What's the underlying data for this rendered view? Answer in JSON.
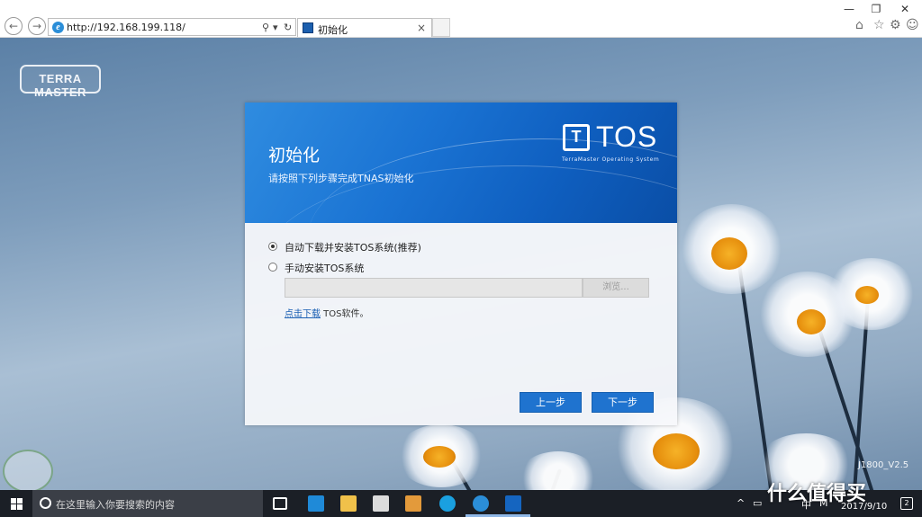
{
  "browser": {
    "url": "http://192.168.199.118/",
    "tab_title": "初始化",
    "tab_close": "×",
    "window_controls": {
      "minimize": "—",
      "restore": "❐",
      "close": "✕"
    },
    "toolbar_icons": [
      "home-icon",
      "star-icon",
      "gear-icon",
      "smiley-icon"
    ]
  },
  "desktop": {
    "logo_text": "TERRA MASTER",
    "version": "J1800_V2.5"
  },
  "dialog": {
    "title": "初始化",
    "subtitle": "请按照下列步骤完成TNAS初始化",
    "brand_mark": "T",
    "brand_name": "TOS",
    "brand_tagline": "TerraMaster Operating System",
    "options": [
      {
        "label": "自动下载并安装TOS系统(推荐)",
        "selected": true
      },
      {
        "label": "手动安装TOS系统",
        "selected": false
      }
    ],
    "file_input_value": "",
    "browse_label": "浏览...",
    "download_link": "点击下载",
    "download_suffix": " TOS软件。",
    "prev_button": "上一步",
    "next_button": "下一步",
    "accent_color": "#1f73cf"
  },
  "taskbar": {
    "search_placeholder": "在这里输入你要搜索的内容",
    "tray_chevron": "^",
    "ime_mode": "中",
    "ime_layout": "M",
    "clock_date": "2017/9/10",
    "notification_count": "2",
    "watermark": "什么值得买"
  }
}
